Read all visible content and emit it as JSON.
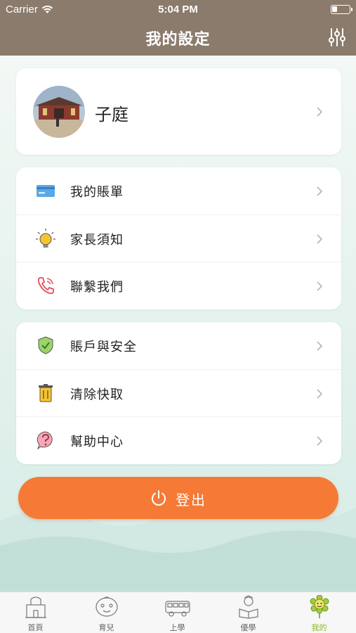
{
  "status_bar": {
    "carrier": "Carrier",
    "time": "5:04 PM",
    "wifi_icon": "wifi-icon",
    "battery_icon": "battery-icon"
  },
  "nav": {
    "title": "我的設定",
    "settings_icon": "sliders-icon"
  },
  "profile": {
    "name": "子庭",
    "avatar_icon": "avatar-photo"
  },
  "menu_group_1": [
    {
      "label": "我的賬單",
      "icon": "credit-card-icon"
    },
    {
      "label": "家長須知",
      "icon": "lightbulb-icon"
    },
    {
      "label": "聯繫我們",
      "icon": "phone-icon"
    }
  ],
  "menu_group_2": [
    {
      "label": "賬戶與安全",
      "icon": "shield-check-icon"
    },
    {
      "label": "清除快取",
      "icon": "trash-icon"
    },
    {
      "label": "幫助中心",
      "icon": "question-bubble-icon"
    }
  ],
  "logout": {
    "label": "登出",
    "icon": "power-icon"
  },
  "tabs": [
    {
      "label": "首頁",
      "icon": "home-building-icon",
      "active": false
    },
    {
      "label": "育兒",
      "icon": "baby-face-icon",
      "active": false
    },
    {
      "label": "上學",
      "icon": "school-bus-icon",
      "active": false
    },
    {
      "label": "優學",
      "icon": "reading-child-icon",
      "active": false
    },
    {
      "label": "我的",
      "icon": "flower-person-icon",
      "active": true
    }
  ],
  "colors": {
    "header": "#8b7b6c",
    "accent": "#f57a35",
    "active_tab": "#8fb82a",
    "background": "#eef6f3"
  }
}
